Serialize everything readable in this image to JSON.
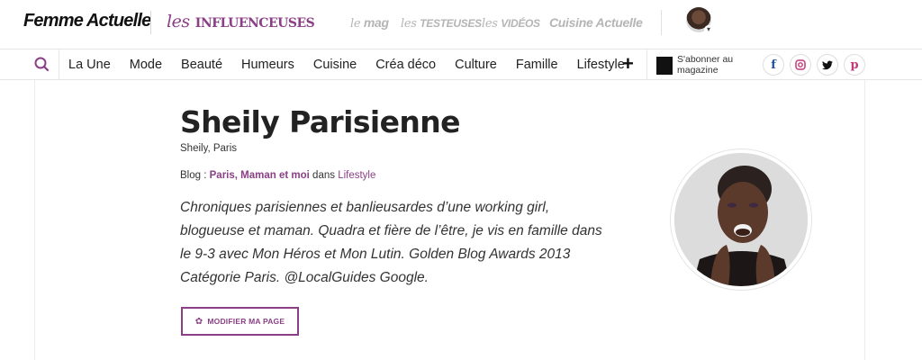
{
  "header": {
    "brand": "Femme Actuelle",
    "brand_secondary_les": "les",
    "brand_secondary_main": "influenceuses",
    "top_nav": [
      {
        "prefix": "le",
        "label": "mag"
      },
      {
        "prefix": "les",
        "label": "testeuses"
      },
      {
        "prefix": "les",
        "label": "vidéos"
      },
      {
        "prefix": "",
        "label": "Cuisine Actuelle"
      }
    ]
  },
  "nav": {
    "items": [
      "La Une",
      "Mode",
      "Beauté",
      "Humeurs",
      "Cuisine",
      "Créa déco",
      "Culture",
      "Famille",
      "Lifestyle"
    ],
    "plus": "+",
    "subscribe": "S'abonner au magazine",
    "socials": [
      {
        "icon": "facebook-icon",
        "glyph": "f",
        "color": "#1f4fa0"
      },
      {
        "icon": "instagram-icon",
        "glyph": "◎",
        "color": "#c23a7a"
      },
      {
        "icon": "twitter-icon",
        "glyph": "t",
        "color": "#111111"
      },
      {
        "icon": "pinterest-icon",
        "glyph": "p",
        "color": "#c23a7a"
      }
    ]
  },
  "profile": {
    "name": "Sheily Parisienne",
    "location": "Sheily, Paris",
    "blog_label": "Blog :",
    "blog_name": "Paris, Maman et moi",
    "blog_in": "dans",
    "blog_category": "Lifestyle",
    "bio": "Chroniques parisiennes et banlieusardes d’une working girl, blogueuse et maman. Quadra et fière de l’être, je vis en famille dans le 9-3 avec Mon Héros et Mon Lutin. Golden Blog Awards 2013 Catégorie Paris. @LocalGuides Google.",
    "edit_button": "MODIFIER MA PAGE"
  },
  "colors": {
    "accent": "#8b3f86",
    "text": "#222222",
    "muted": "#b5b5b5"
  }
}
